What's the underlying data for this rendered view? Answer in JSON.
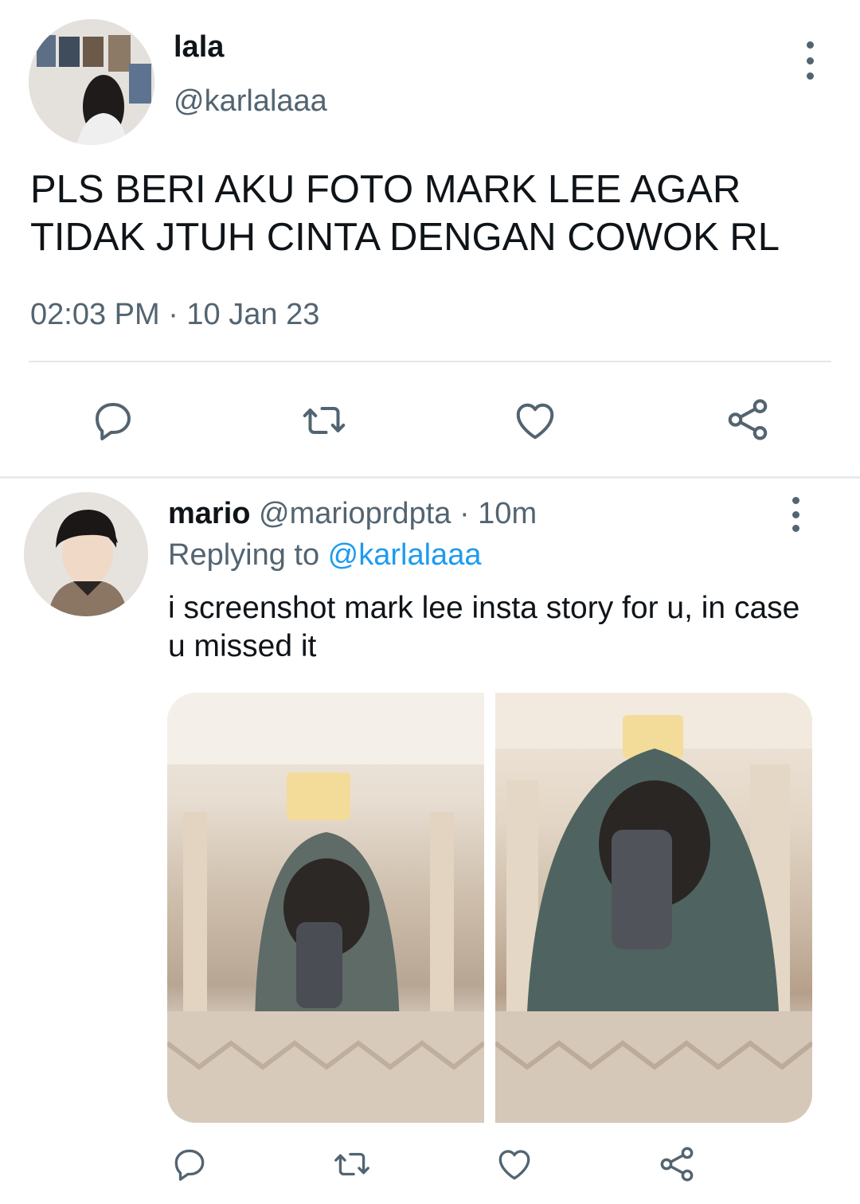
{
  "tweet": {
    "display_name": "lala",
    "handle": "@karlalaaa",
    "text": "PLS BERI AKU FOTO MARK LEE AGAR TIDAK JTUH CINTA DENGAN COWOK RL",
    "timestamp": "02:03 PM · 10 Jan 23",
    "actions": [
      "reply-icon",
      "retweet-icon",
      "like-icon",
      "share-icon"
    ]
  },
  "reply": {
    "display_name": "mario",
    "handle": "@marioprdpta",
    "separator": " · ",
    "time": "10m",
    "replying_prefix": "Replying to ",
    "replying_to": "@karlalaaa",
    "text": "i screenshot mark lee insta story for u, in case u missed it",
    "media_count": 2,
    "actions": [
      "reply-icon",
      "retweet-icon",
      "like-icon",
      "share-icon"
    ]
  },
  "colors": {
    "text": "#0f1419",
    "secondary": "#536471",
    "link": "#1d9bf0",
    "divider": "#e1e6ea"
  }
}
